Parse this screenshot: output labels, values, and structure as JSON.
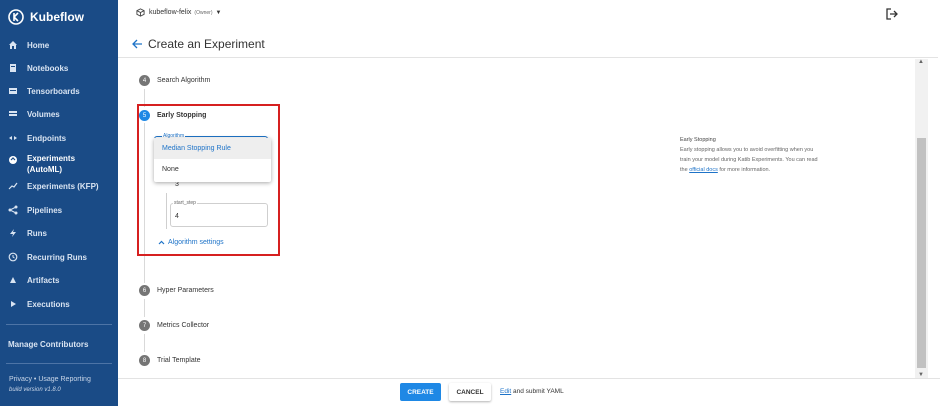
{
  "app": {
    "name": "Kubeflow"
  },
  "namespace": {
    "name": "kubeflow-felix",
    "role": "(Owner)"
  },
  "sidebar": {
    "items": [
      {
        "label": "Home"
      },
      {
        "label": "Notebooks"
      },
      {
        "label": "Tensorboards"
      },
      {
        "label": "Volumes"
      },
      {
        "label": "Endpoints"
      },
      {
        "label": "Experiments\n(AutoML)"
      },
      {
        "label": "Experiments (KFP)"
      },
      {
        "label": "Pipelines"
      },
      {
        "label": "Runs"
      },
      {
        "label": "Recurring Runs"
      },
      {
        "label": "Artifacts"
      },
      {
        "label": "Executions"
      }
    ],
    "manage_contributors": "Manage Contributors",
    "privacy": "Privacy",
    "usage_reporting": "Usage Reporting",
    "build_version": "build version v1.8.0"
  },
  "header": {
    "title": "Create an Experiment"
  },
  "steps": {
    "s4": {
      "num": "4",
      "label": "Search Algorithm"
    },
    "s5": {
      "num": "5",
      "label": "Early Stopping"
    },
    "s6": {
      "num": "6",
      "label": "Hyper Parameters"
    },
    "s7": {
      "num": "7",
      "label": "Metrics Collector"
    },
    "s8": {
      "num": "8",
      "label": "Trial Template"
    }
  },
  "early_stopping": {
    "algorithm_label": "Algorithm",
    "options": [
      "Median Stopping Rule",
      "None"
    ],
    "selected": "Median Stopping Rule",
    "param1_value": "3",
    "start_step_label": "start_step",
    "start_step_value": "4",
    "algorithm_settings": "Algorithm settings"
  },
  "help": {
    "title": "Early Stopping",
    "text1": "Early stopping allows you to avoid overfitting when you train your model during Katib Experiments. You can read the ",
    "link": "official docs",
    "text2": " for more information."
  },
  "actions": {
    "create": "CREATE",
    "cancel": "CANCEL",
    "edit": "Edit",
    "submit_yaml": " and submit YAML"
  },
  "colors": {
    "sidebar": "#1a4b86",
    "accent": "#1e88e5",
    "highlight": "#d62020"
  }
}
